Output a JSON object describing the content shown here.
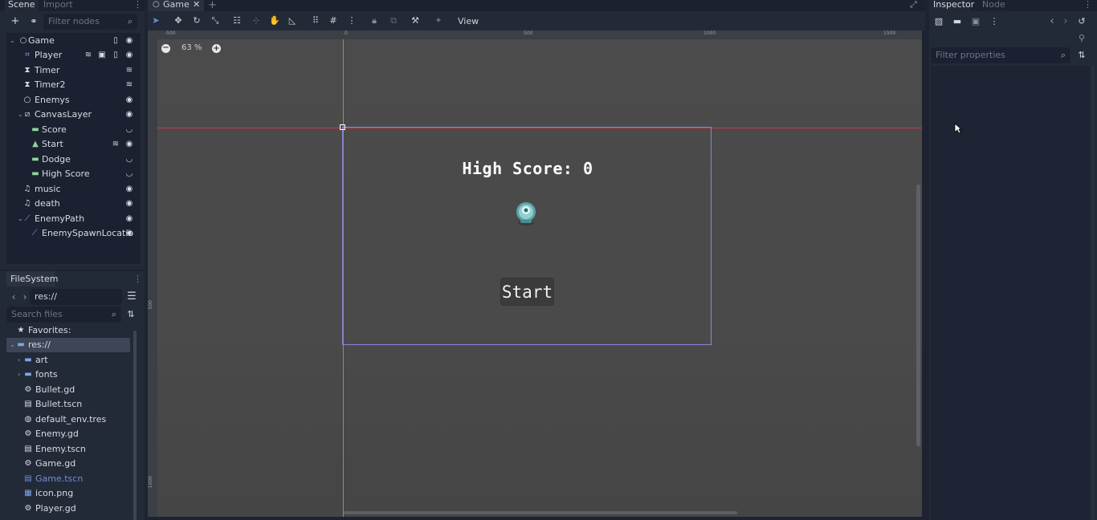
{
  "scene_dock": {
    "tabs": [
      "Scene",
      "Import"
    ],
    "filter_placeholder": "Filter nodes",
    "nodes": [
      {
        "label": "Game",
        "icon": "node2d-circle-icon",
        "depth": 0,
        "expanded": true
      },
      {
        "label": "Player",
        "icon": "area2d-icon",
        "depth": 1
      },
      {
        "label": "Timer",
        "icon": "timer-icon",
        "depth": 1
      },
      {
        "label": "Timer2",
        "icon": "timer-icon",
        "depth": 1
      },
      {
        "label": "Enemys",
        "icon": "node-circle-icon",
        "depth": 1
      },
      {
        "label": "CanvasLayer",
        "icon": "canvaslayer-icon",
        "depth": 1,
        "expanded": true
      },
      {
        "label": "Score",
        "icon": "label-icon",
        "depth": 2
      },
      {
        "label": "Start",
        "icon": "button-icon",
        "depth": 2
      },
      {
        "label": "Dodge",
        "icon": "label-icon",
        "depth": 2
      },
      {
        "label": "High Score",
        "icon": "label-icon",
        "depth": 2
      },
      {
        "label": "music",
        "icon": "audio-icon",
        "depth": 1
      },
      {
        "label": "death",
        "icon": "audio-icon",
        "depth": 1
      },
      {
        "label": "EnemyPath",
        "icon": "path-icon",
        "depth": 1,
        "expanded": true
      },
      {
        "label": "EnemySpawnLocatio",
        "icon": "pathfollow-icon",
        "depth": 2
      }
    ]
  },
  "filesystem": {
    "title": "FileSystem",
    "path": "res://",
    "search_placeholder": "Search files",
    "items": [
      {
        "label": "Favorites:",
        "icon": "star-icon"
      },
      {
        "label": "res://",
        "icon": "folder-icon",
        "selected": true
      },
      {
        "label": "art",
        "icon": "folder-icon"
      },
      {
        "label": "fonts",
        "icon": "folder-icon"
      },
      {
        "label": "Bullet.gd",
        "icon": "gear-icon"
      },
      {
        "label": "Bullet.tscn",
        "icon": "clapper-icon"
      },
      {
        "label": "default_env.tres",
        "icon": "globe-icon"
      },
      {
        "label": "Enemy.gd",
        "icon": "gear-icon"
      },
      {
        "label": "Enemy.tscn",
        "icon": "clapper-icon"
      },
      {
        "label": "Game.gd",
        "icon": "gear-icon"
      },
      {
        "label": "Game.tscn",
        "icon": "clapper-icon",
        "highlight": true
      },
      {
        "label": "icon.png",
        "icon": "image-icon"
      },
      {
        "label": "Player.gd",
        "icon": "gear-icon"
      }
    ]
  },
  "main": {
    "tab_label": "Game",
    "view_menu": "View",
    "zoom_label": "63 %",
    "ruler_top": [
      "-500",
      "0",
      "500",
      "1000",
      "1500"
    ],
    "ruler_left": [
      "500",
      "1000"
    ],
    "high_score_text": "High Score: 0",
    "start_label": "Start"
  },
  "inspector": {
    "tabs": [
      "Inspector",
      "Node"
    ],
    "filter_placeholder": "Filter properties"
  },
  "colors": {
    "accent": "#6b8fd9",
    "guide_red": "#c03a55",
    "guide_green": "#6ea54a",
    "game_rect": "#8a86d8"
  }
}
